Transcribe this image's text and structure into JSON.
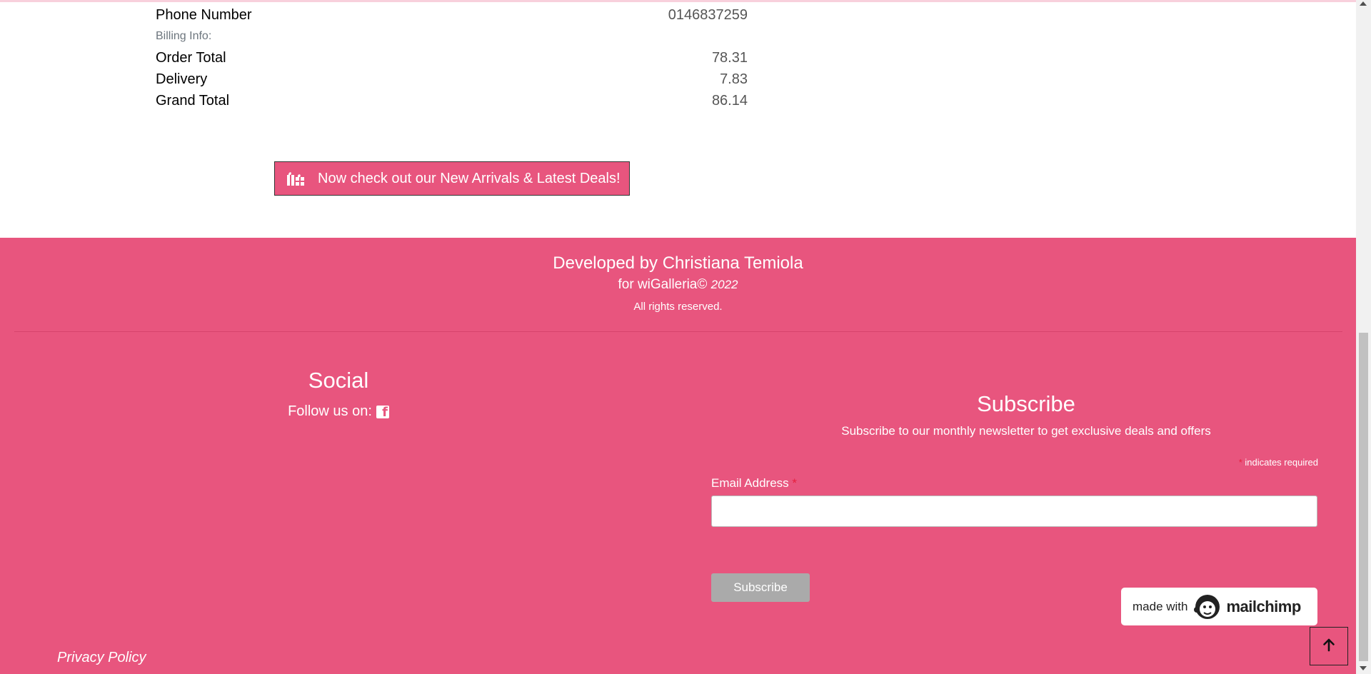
{
  "summary": {
    "phone_label": "Phone Number",
    "phone_value": "0146837259",
    "billing_label": "Billing Info:",
    "order_total_label": "Order Total",
    "order_total_value": "78.31",
    "delivery_label": "Delivery",
    "delivery_value": "7.83",
    "grand_total_label": "Grand Total",
    "grand_total_value": "86.14"
  },
  "deals_button": {
    "icon": "gift-icon",
    "label": "Now check out our New Arrivals & Latest Deals!"
  },
  "footer": {
    "developed_by": "Developed by Christiana Temiola",
    "for_prefix": "for wiGalleria©",
    "year": "2022",
    "rights": "All rights reserved.",
    "social_title": "Social",
    "follow_label": "Follow us on:",
    "follow_icon": "facebook-icon",
    "subscribe_title": "Subscribe",
    "subscribe_desc": "Subscribe to our monthly newsletter to get exclusive deals and offers",
    "required_asterisk": "*",
    "required_note": "indicates required",
    "email_label": "Email Address",
    "email_asterisk": "*",
    "email_value": "",
    "subscribe_button": "Subscribe",
    "mailchimp_made": "made with",
    "mailchimp_brand": "mailchimp",
    "privacy": "Privacy Policy",
    "back_to_top_icon": "arrow-up-icon"
  },
  "colors": {
    "accent": "#e8557e",
    "required": "#e6213f",
    "button_disabled": "#aaaaaa"
  }
}
